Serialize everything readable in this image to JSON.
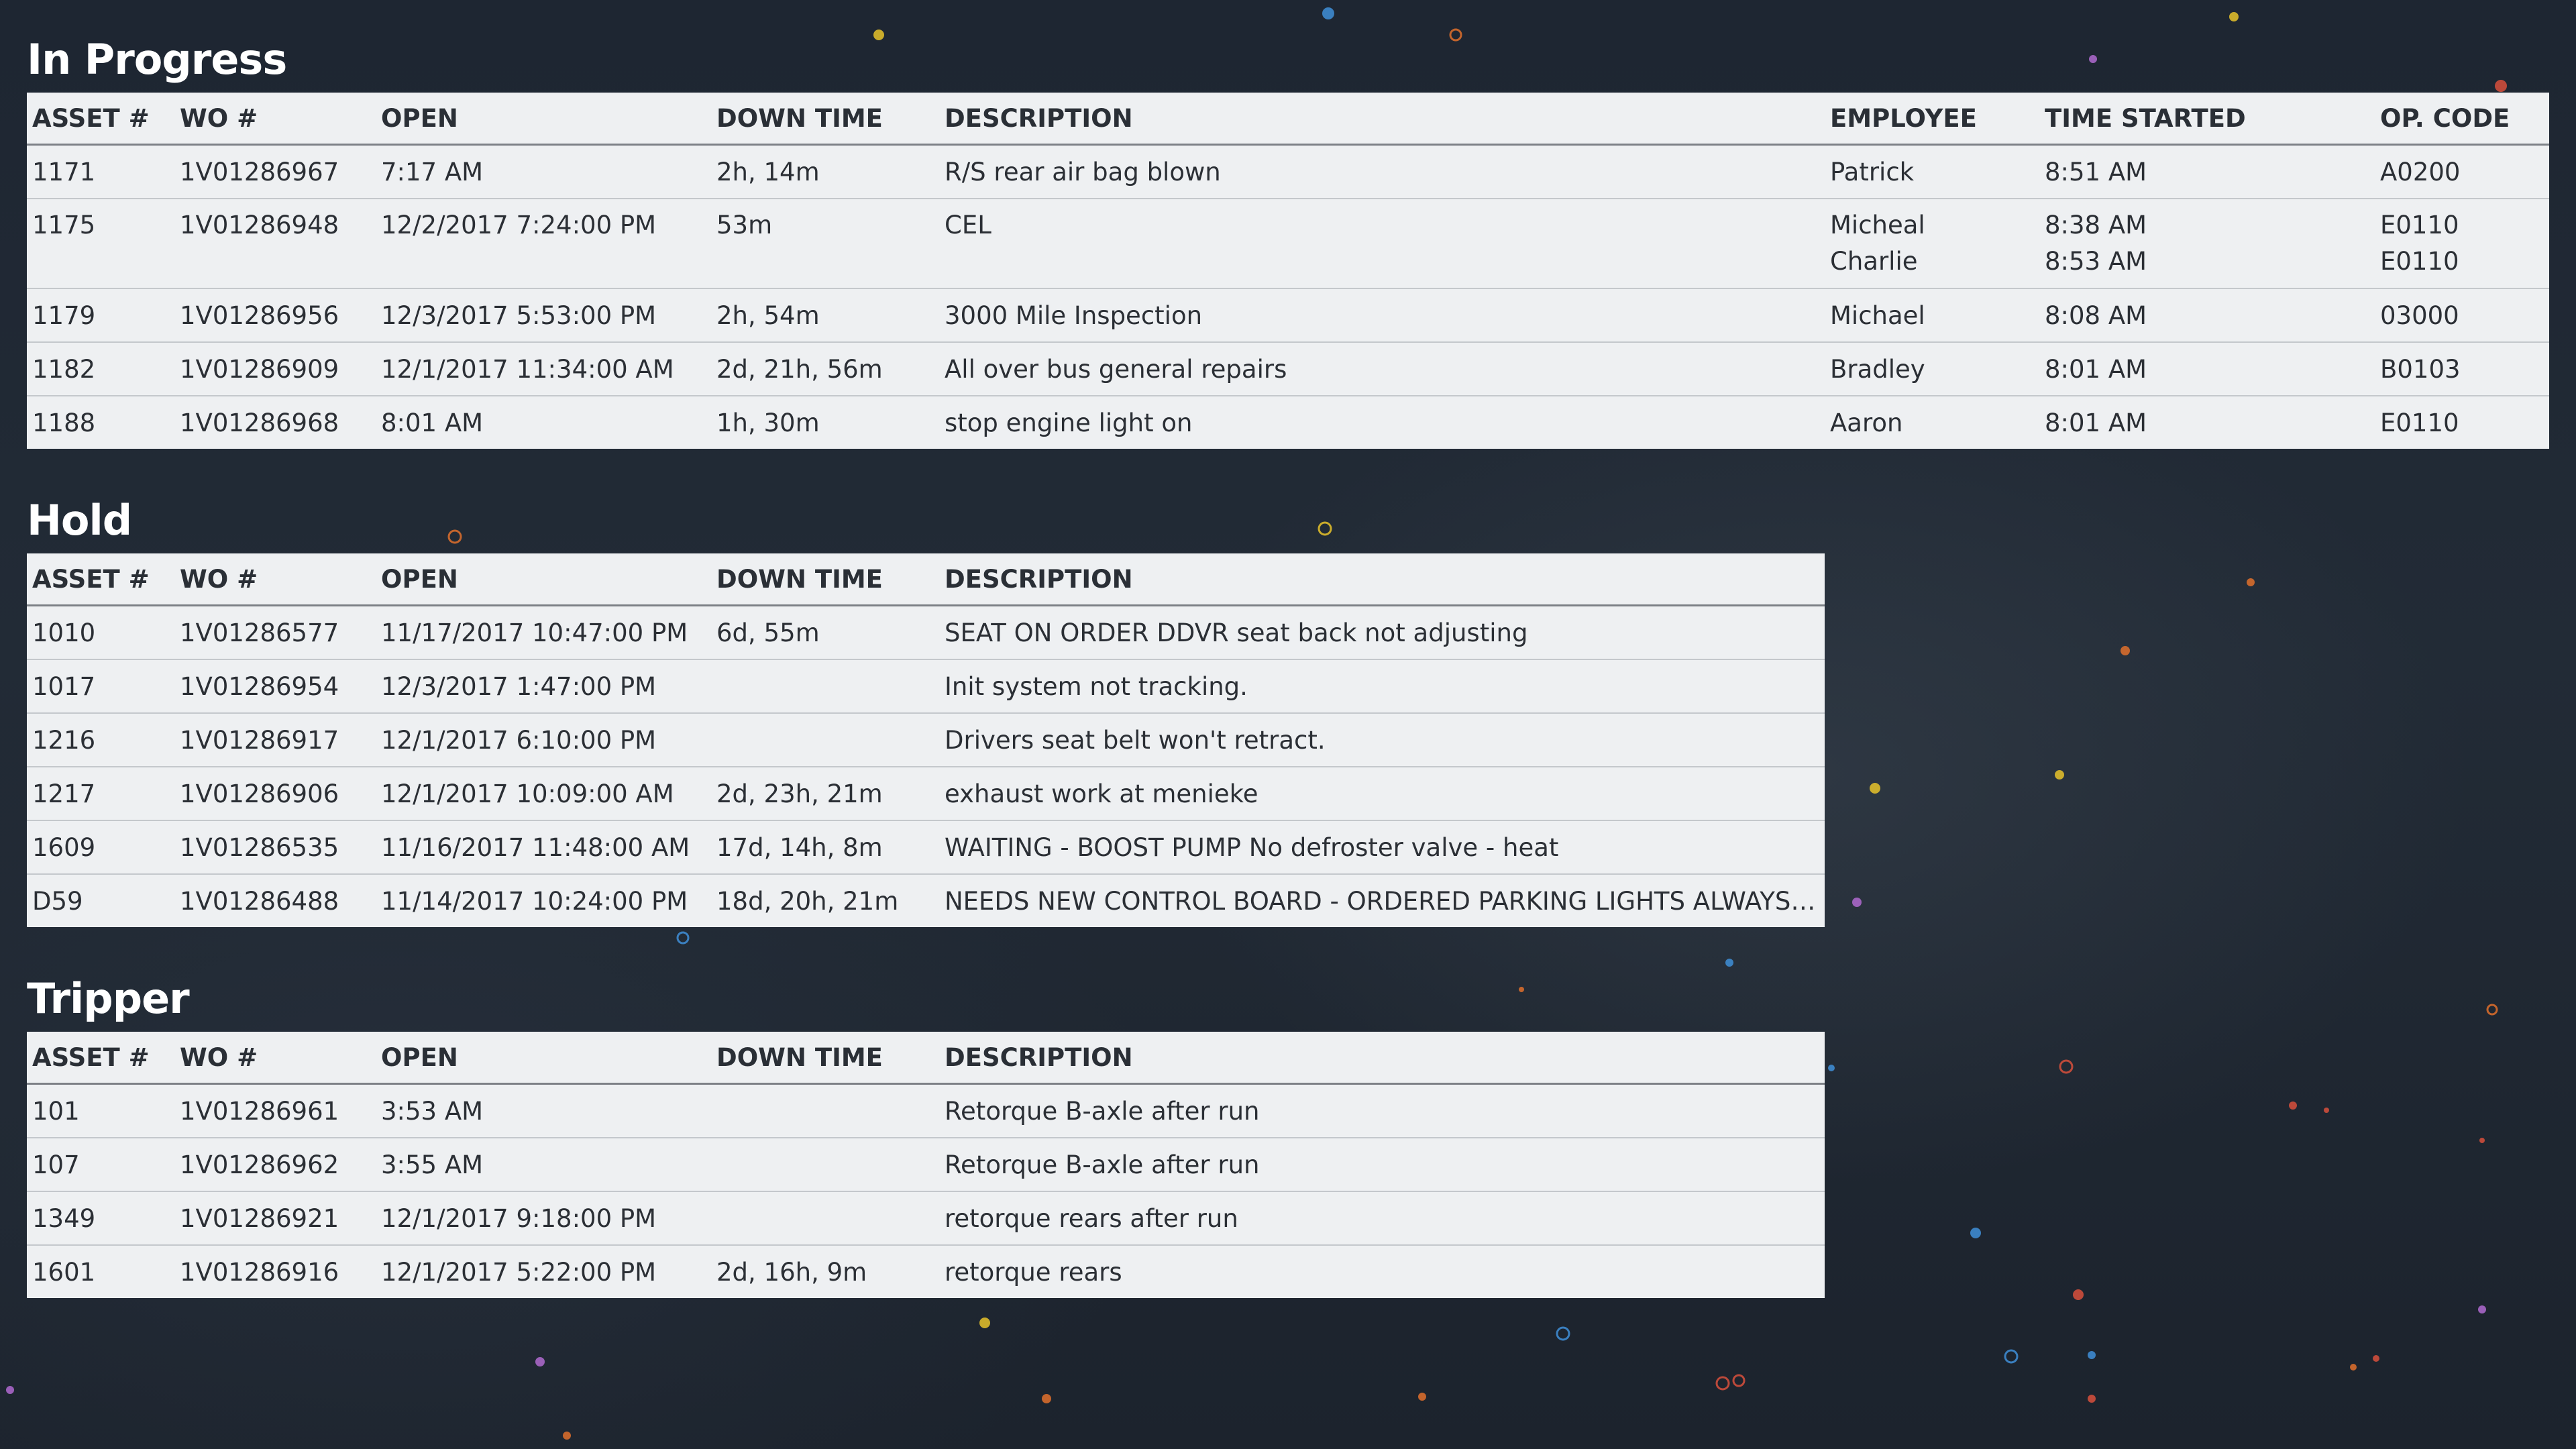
{
  "sections": {
    "in_progress": {
      "title": "In Progress",
      "headers": [
        "ASSET #",
        "WO #",
        "OPEN",
        "DOWN TIME",
        "DESCRIPTION",
        "EMPLOYEE",
        "TIME STARTED",
        "OP. CODE"
      ],
      "rows": [
        {
          "asset": "1171",
          "wo": "1V01286967",
          "open": "7:17 AM",
          "down": "2h, 14m",
          "desc": "R/S rear air bag blown",
          "employees": [
            "Patrick"
          ],
          "started": [
            "8:51 AM"
          ],
          "op": [
            "A0200"
          ]
        },
        {
          "asset": "1175",
          "wo": "1V01286948",
          "open": "12/2/2017 7:24:00 PM",
          "down": "53m",
          "desc": "CEL",
          "employees": [
            "Micheal",
            "Charlie"
          ],
          "started": [
            "8:38 AM",
            "8:53 AM"
          ],
          "op": [
            "E0110",
            "E0110"
          ]
        },
        {
          "asset": "1179",
          "wo": "1V01286956",
          "open": "12/3/2017 5:53:00 PM",
          "down": "2h, 54m",
          "desc": "3000 Mile Inspection",
          "employees": [
            "Michael"
          ],
          "started": [
            "8:08 AM"
          ],
          "op": [
            "03000"
          ]
        },
        {
          "asset": "1182",
          "wo": "1V01286909",
          "open": "12/1/2017 11:34:00 AM",
          "down": "2d, 21h, 56m",
          "desc": "All over bus general repairs",
          "employees": [
            "Bradley"
          ],
          "started": [
            "8:01 AM"
          ],
          "op": [
            "B0103"
          ]
        },
        {
          "asset": "1188",
          "wo": "1V01286968",
          "open": "8:01 AM",
          "down": "1h, 30m",
          "desc": "stop engine light on",
          "employees": [
            "Aaron"
          ],
          "started": [
            "8:01 AM"
          ],
          "op": [
            "E0110"
          ]
        }
      ]
    },
    "hold": {
      "title": "Hold",
      "headers": [
        "ASSET #",
        "WO #",
        "OPEN",
        "DOWN TIME",
        "DESCRIPTION"
      ],
      "rows": [
        {
          "asset": "1010",
          "wo": "1V01286577",
          "open": "11/17/2017 10:47:00 PM",
          "down": "6d, 55m",
          "desc": "SEAT ON ORDER DDVR seat back not adjusting"
        },
        {
          "asset": "1017",
          "wo": "1V01286954",
          "open": "12/3/2017 1:47:00 PM",
          "down": "",
          "desc": "Init system not tracking."
        },
        {
          "asset": "1216",
          "wo": "1V01286917",
          "open": "12/1/2017 6:10:00 PM",
          "down": "",
          "desc": "Drivers seat belt won't retract."
        },
        {
          "asset": "1217",
          "wo": "1V01286906",
          "open": "12/1/2017 10:09:00 AM",
          "down": "2d, 23h, 21m",
          "desc": "exhaust work at menieke"
        },
        {
          "asset": "1609",
          "wo": "1V01286535",
          "open": "11/16/2017 11:48:00 AM",
          "down": "17d, 14h, 8m",
          "desc": "WAITING - BOOST PUMP No defroster valve - heat"
        },
        {
          "asset": "D59",
          "wo": "1V01286488",
          "open": "11/14/2017 10:24:00 PM",
          "down": "18d, 20h, 21m",
          "desc": "NEEDS NEW CONTROL BOARD - ORDERED PARKING LIGHTS ALWAYS ..."
        }
      ]
    },
    "tripper": {
      "title": "Tripper",
      "headers": [
        "ASSET #",
        "WO #",
        "OPEN",
        "DOWN TIME",
        "DESCRIPTION"
      ],
      "rows": [
        {
          "asset": "101",
          "wo": "1V01286961",
          "open": "3:53 AM",
          "down": "",
          "desc": "Retorque B-axle after run"
        },
        {
          "asset": "107",
          "wo": "1V01286962",
          "open": "3:55 AM",
          "down": "",
          "desc": "Retorque B-axle after run"
        },
        {
          "asset": "1349",
          "wo": "1V01286921",
          "open": "12/1/2017 9:18:00 PM",
          "down": "",
          "desc": "retorque rears after run"
        },
        {
          "asset": "1601",
          "wo": "1V01286916",
          "open": "12/1/2017 5:22:00 PM",
          "down": "2d, 16h, 9m",
          "desc": "retorque rears"
        }
      ]
    }
  },
  "theme": {
    "background": "#1f2733",
    "table_background": "#eef0f2",
    "title_color": "#ffffff",
    "particle_colors": [
      "#e8c32a",
      "#3f8fd8",
      "#e0702c",
      "#b06ad0",
      "#d8503c"
    ]
  }
}
